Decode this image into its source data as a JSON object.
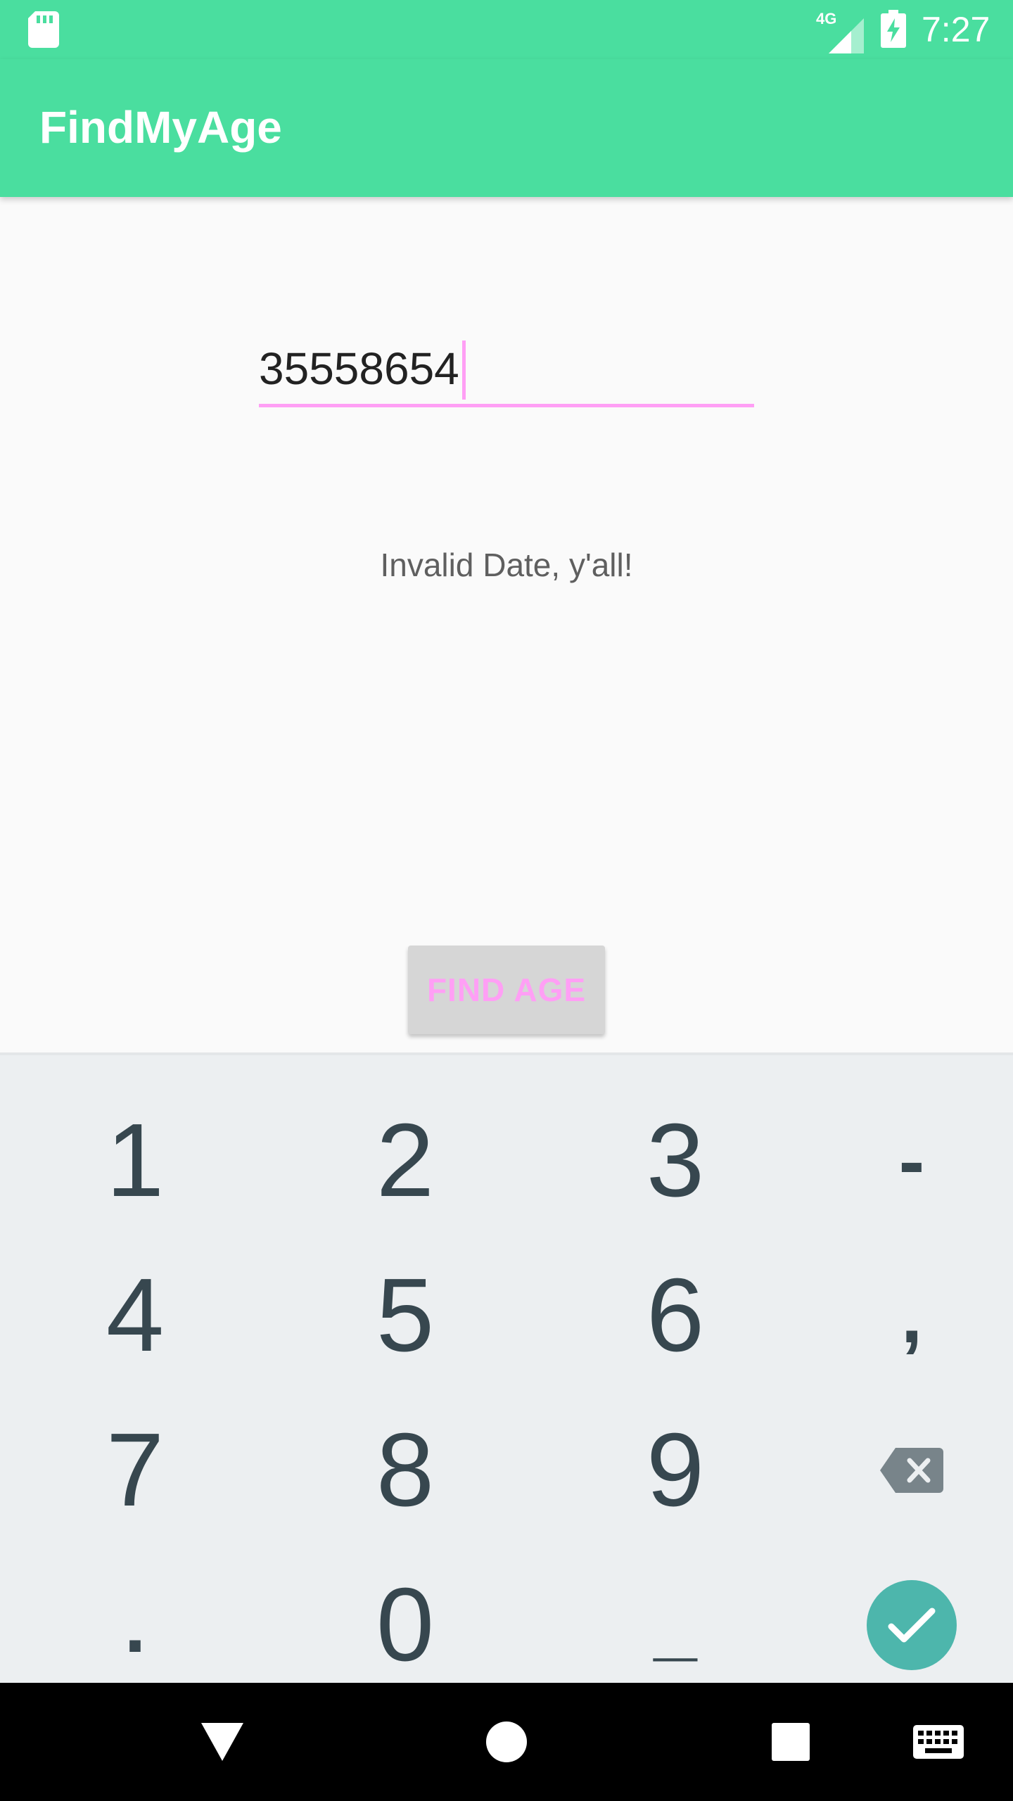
{
  "status_bar": {
    "network_type": "4G",
    "time": "7:27",
    "icons": [
      "sd-card-icon",
      "signal-icon",
      "battery-charging-icon"
    ]
  },
  "app_bar": {
    "title": "FindMyAge"
  },
  "form": {
    "date_input_value": "35558654",
    "result_text": "Invalid Date, y'all!",
    "find_button_label": "FIND AGE"
  },
  "keyboard": {
    "rows": [
      [
        "1",
        "2",
        "3",
        "-"
      ],
      [
        "4",
        "5",
        "6",
        ","
      ],
      [
        "7",
        "8",
        "9",
        "backspace-icon"
      ],
      [
        ".",
        "0",
        "_",
        "confirm-icon"
      ]
    ]
  },
  "nav_bar": {
    "icons": [
      "back-icon",
      "home-icon",
      "recents-icon",
      "keyboard-switch-icon"
    ]
  },
  "colors": {
    "primary": "#4ade9f",
    "accent": "#ff9ff5",
    "confirm": "#4db6ac",
    "key_text": "#37474f",
    "keyboard_bg": "#eceff1"
  }
}
